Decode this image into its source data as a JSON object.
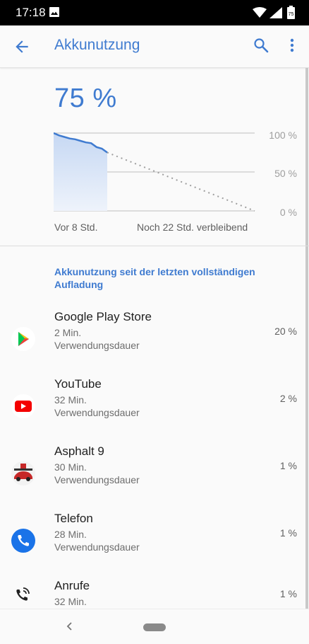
{
  "status_bar": {
    "time": "17:18",
    "battery_digit": "75"
  },
  "app_bar": {
    "title": "Akkunutzung",
    "back_icon": "arrow-back-icon",
    "search_icon": "search-icon",
    "more_icon": "more-vert-icon"
  },
  "battery": {
    "percent_label": "75 %",
    "axis": {
      "top": "100 %",
      "mid": "50 %",
      "bottom": "0 %"
    },
    "time_left": "Vor 8 Std.",
    "time_right": "Noch 22 Std. verbleibend",
    "accent_color": "#3f7bd0"
  },
  "chart_data": {
    "type": "area",
    "ylim": [
      0,
      100
    ],
    "tick_labels": [
      "100 %",
      "50 %",
      "0 %"
    ],
    "x_labels": [
      "Vor 8 Std.",
      "Noch 22 Std. verbleibend"
    ],
    "series": [
      {
        "values": [
          100,
          97,
          95,
          93,
          92,
          90,
          88,
          87,
          82,
          80,
          75
        ]
      }
    ],
    "projection": {
      "from": 75,
      "to": 0
    },
    "grid": true
  },
  "section_title": "Akkunutzung seit der letzten vollständigen Aufladung",
  "apps": [
    {
      "name": "Google Play Store",
      "duration": "2 Min.",
      "usage_label": "Verwendungsdauer",
      "percent": "20 %",
      "icon": "google-play-icon"
    },
    {
      "name": "YouTube",
      "duration": "32 Min.",
      "usage_label": "Verwendungsdauer",
      "percent": "2 %",
      "icon": "youtube-icon"
    },
    {
      "name": "Asphalt 9",
      "duration": "30 Min.",
      "usage_label": "Verwendungsdauer",
      "percent": "1 %",
      "icon": "asphalt-9-icon"
    },
    {
      "name": "Telefon",
      "duration": "28 Min.",
      "usage_label": "Verwendungsdauer",
      "percent": "1 %",
      "icon": "phone-icon"
    },
    {
      "name": "Anrufe",
      "duration": "32 Min.",
      "usage_label": "",
      "percent": "1 %",
      "icon": "calls-icon"
    }
  ]
}
